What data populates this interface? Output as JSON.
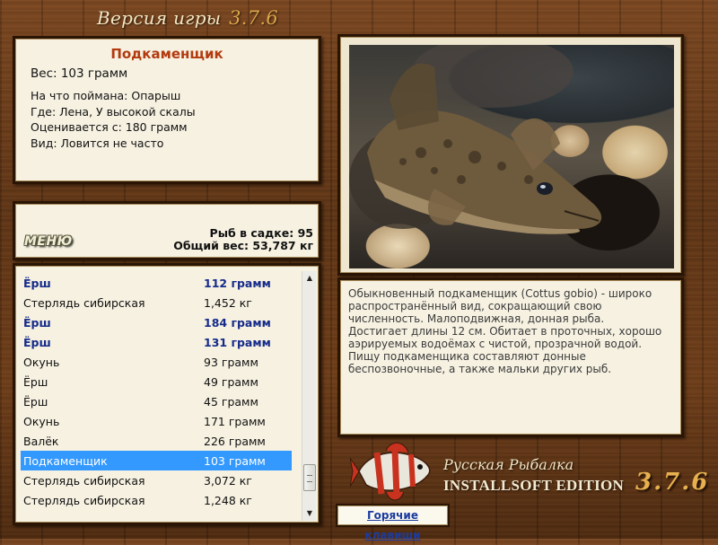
{
  "header": {
    "title": "Версия игры",
    "version": "3.7.6"
  },
  "catch_info": {
    "fish_name": "Подкаменщик",
    "weight_line": "Вес: 103 грамм",
    "bait_line": "На что поймана: Опарыш",
    "place_line": "Где: Лена, У высокой скалы",
    "value_line": "Оценивается с: 180 грамм",
    "kind_line": "Вид: Ловится не часто"
  },
  "stats": {
    "menu_label": "МЕНЮ",
    "fish_count_line": "Рыб в садке: 95",
    "total_weight_line": "Общий вес: 53,787 кг"
  },
  "catch_list": {
    "rows": [
      {
        "name": "Ёрш",
        "weight": "112 грамм",
        "bold": true
      },
      {
        "name": "Стерлядь сибирская",
        "weight": "1,452 кг",
        "bold": false
      },
      {
        "name": "Ёрш",
        "weight": "184 грамм",
        "bold": true
      },
      {
        "name": "Ёрш",
        "weight": "131 грамм",
        "bold": true
      },
      {
        "name": "Окунь",
        "weight": "93 грамм",
        "bold": false
      },
      {
        "name": "Ёрш",
        "weight": "49 грамм",
        "bold": false
      },
      {
        "name": "Ёрш",
        "weight": "45 грамм",
        "bold": false
      },
      {
        "name": "Окунь",
        "weight": "171 грамм",
        "bold": false
      },
      {
        "name": "Валёк",
        "weight": "226 грамм",
        "bold": false
      },
      {
        "name": "Подкаменщик",
        "weight": "103 грамм",
        "bold": false,
        "selected": true
      },
      {
        "name": "Стерлядь сибирская",
        "weight": "3,072 кг",
        "bold": false
      },
      {
        "name": "Стерлядь сибирская",
        "weight": "1,248 кг",
        "bold": false
      }
    ],
    "scroll_position": 0.92
  },
  "description": {
    "lines": [
      "Обыкновенный подкаменщик (Cottus gobio) - широко",
      "распространённый вид, сокращающий свою",
      "численность. Малоподвижная, донная рыба.",
      "Достигает длины 12 см. Обитает в проточных, хорошо",
      "аэрируемых водоёмах с чистой, прозрачной водой.",
      "Пищу подкаменщика составляют донные",
      "беспозвоночные, а также мальки других рыб."
    ]
  },
  "branding": {
    "name": "Русская Рыбалка",
    "edition": "INSTALLSOFT EDITION",
    "version": "3.7.6"
  },
  "buttons": {
    "hotkeys": "Горячие клавиши"
  },
  "icons": {
    "photo": "fish-photo",
    "logo": "fish-logo-icon",
    "scroll_up": "arrow-up-icon",
    "scroll_down": "arrow-down-icon"
  }
}
